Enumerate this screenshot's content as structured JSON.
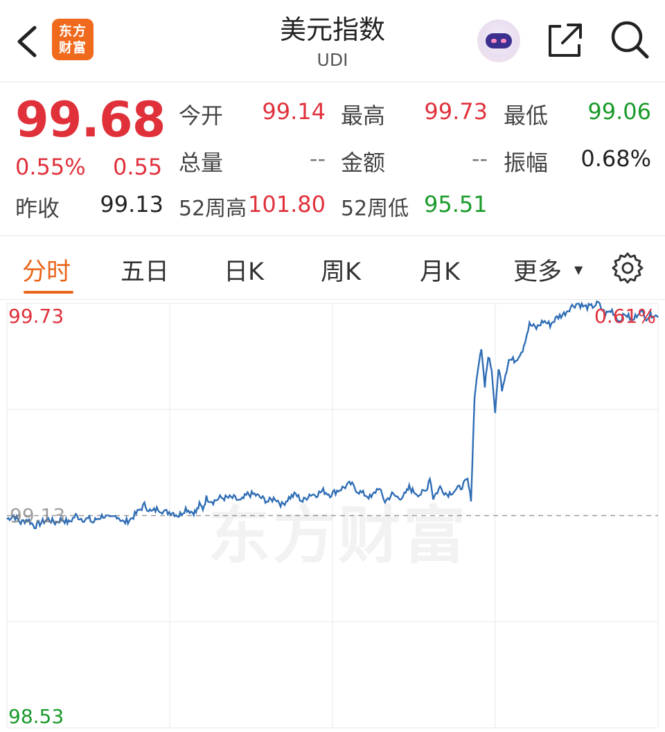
{
  "header": {
    "logo_line1": "东方",
    "logo_line2": "财富",
    "title": "美元指数",
    "subtitle": "UDI"
  },
  "quote": {
    "price": "99.68",
    "change_pct": "0.55%",
    "change_val": "0.55",
    "prev_close_label": "昨收",
    "prev_close": "99.13",
    "open_label": "今开",
    "open": "99.14",
    "high_label": "最高",
    "high": "99.73",
    "low_label": "最低",
    "low": "99.06",
    "volume_label": "总量",
    "volume": "--",
    "amount_label": "金额",
    "amount": "--",
    "amplitude_label": "振幅",
    "amplitude": "0.68%",
    "w52_high_label": "52周高",
    "w52_high": "101.80",
    "w52_low_label": "52周低",
    "w52_low": "95.51"
  },
  "tabs": [
    {
      "label": "分时",
      "active": true
    },
    {
      "label": "五日"
    },
    {
      "label": "日K"
    },
    {
      "label": "周K"
    },
    {
      "label": "月K"
    },
    {
      "label": "更多"
    }
  ],
  "chart": {
    "y_top": "99.73",
    "y_mid": "99.13",
    "y_bottom": "98.53",
    "right_top": "0.61%",
    "watermark": "东方财富",
    "colors": {
      "line": "#2f6db5",
      "up": "#e0313b",
      "down": "#1a9a2a"
    }
  },
  "chart_data": {
    "type": "line",
    "title": "",
    "xlabel": "",
    "ylabel": "",
    "ylim": [
      98.53,
      99.73
    ],
    "reference": 99.13,
    "x": [
      0,
      10,
      20,
      30,
      40,
      50,
      60,
      70,
      80,
      90,
      100,
      110,
      120,
      125,
      130,
      140,
      150,
      160,
      165,
      170,
      180,
      190,
      200,
      210,
      220,
      230,
      240,
      250,
      260,
      270,
      275,
      280,
      285,
      290,
      300,
      310,
      320,
      330,
      340,
      350,
      360,
      370,
      380,
      390,
      400,
      410,
      420,
      430,
      440,
      450,
      460,
      470,
      480,
      490,
      500,
      510,
      520,
      530,
      540,
      550,
      560,
      570,
      580,
      585,
      590,
      600,
      610,
      615,
      620,
      630,
      640,
      650,
      660,
      670,
      675,
      680,
      685,
      690,
      695,
      700,
      705,
      710,
      715,
      720,
      725,
      730,
      740,
      750,
      760,
      770,
      780,
      790,
      800,
      810,
      820,
      830,
      840,
      850,
      860,
      870,
      880,
      890,
      900,
      910,
      920,
      930,
      940,
      947
    ],
    "values": [
      99.12,
      99.13,
      99.11,
      99.12,
      99.1,
      99.11,
      99.12,
      99.11,
      99.12,
      99.11,
      99.13,
      99.12,
      99.12,
      99.11,
      99.12,
      99.13,
      99.12,
      99.13,
      99.12,
      99.11,
      99.12,
      99.14,
      99.16,
      99.14,
      99.15,
      99.14,
      99.14,
      99.13,
      99.15,
      99.14,
      99.14,
      99.16,
      99.15,
      99.18,
      99.17,
      99.18,
      99.18,
      99.18,
      99.17,
      99.19,
      99.19,
      99.18,
      99.17,
      99.18,
      99.16,
      99.18,
      99.19,
      99.17,
      99.19,
      99.19,
      99.2,
      99.19,
      99.2,
      99.21,
      99.22,
      99.2,
      99.19,
      99.18,
      99.21,
      99.17,
      99.19,
      99.18,
      99.19,
      99.21,
      99.2,
      99.19,
      99.2,
      99.24,
      99.18,
      99.21,
      99.19,
      99.2,
      99.21,
      99.23,
      99.17,
      99.46,
      99.55,
      99.6,
      99.5,
      99.58,
      99.54,
      99.42,
      99.55,
      99.49,
      99.53,
      99.57,
      99.57,
      99.6,
      99.67,
      99.66,
      99.68,
      99.67,
      99.69,
      99.7,
      99.72,
      99.73,
      99.72,
      99.72,
      99.73,
      99.7,
      99.71,
      99.68,
      99.7,
      99.68,
      99.71,
      99.69,
      99.7,
      99.69
    ]
  }
}
